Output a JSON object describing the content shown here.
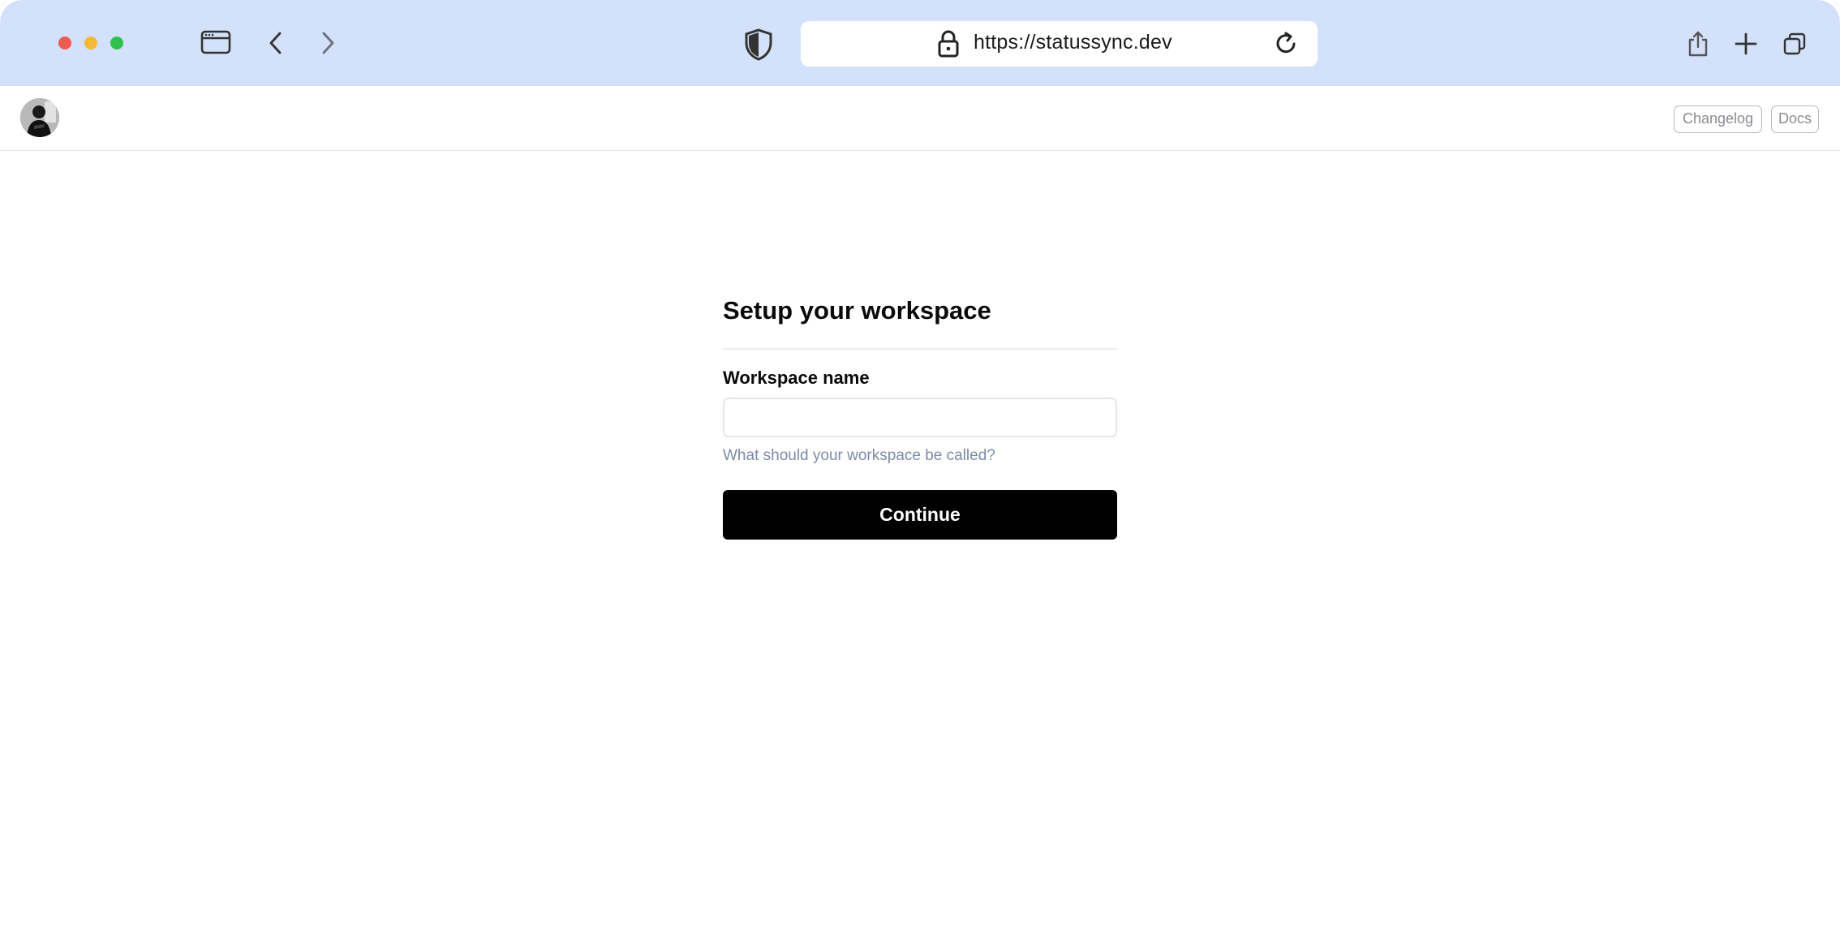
{
  "browser": {
    "url": "https://statussync.dev",
    "icons": [
      "sidebar-icon",
      "back-icon",
      "forward-icon",
      "shield-icon",
      "lock-icon",
      "reload-icon",
      "share-icon",
      "new-tab-icon",
      "tabs-overview-icon"
    ]
  },
  "header": {
    "avatar_icon": "user-avatar",
    "changelog_label": "Changelog",
    "docs_label": "Docs"
  },
  "form": {
    "title": "Setup your workspace",
    "workspace_label": "Workspace name",
    "workspace_value": "",
    "workspace_help": "What should your workspace be called?",
    "continue_label": "Continue"
  },
  "colors": {
    "chrome_bg": "#d3e1fb",
    "primary_button": "#000000",
    "help_text": "#7d8aa8"
  }
}
